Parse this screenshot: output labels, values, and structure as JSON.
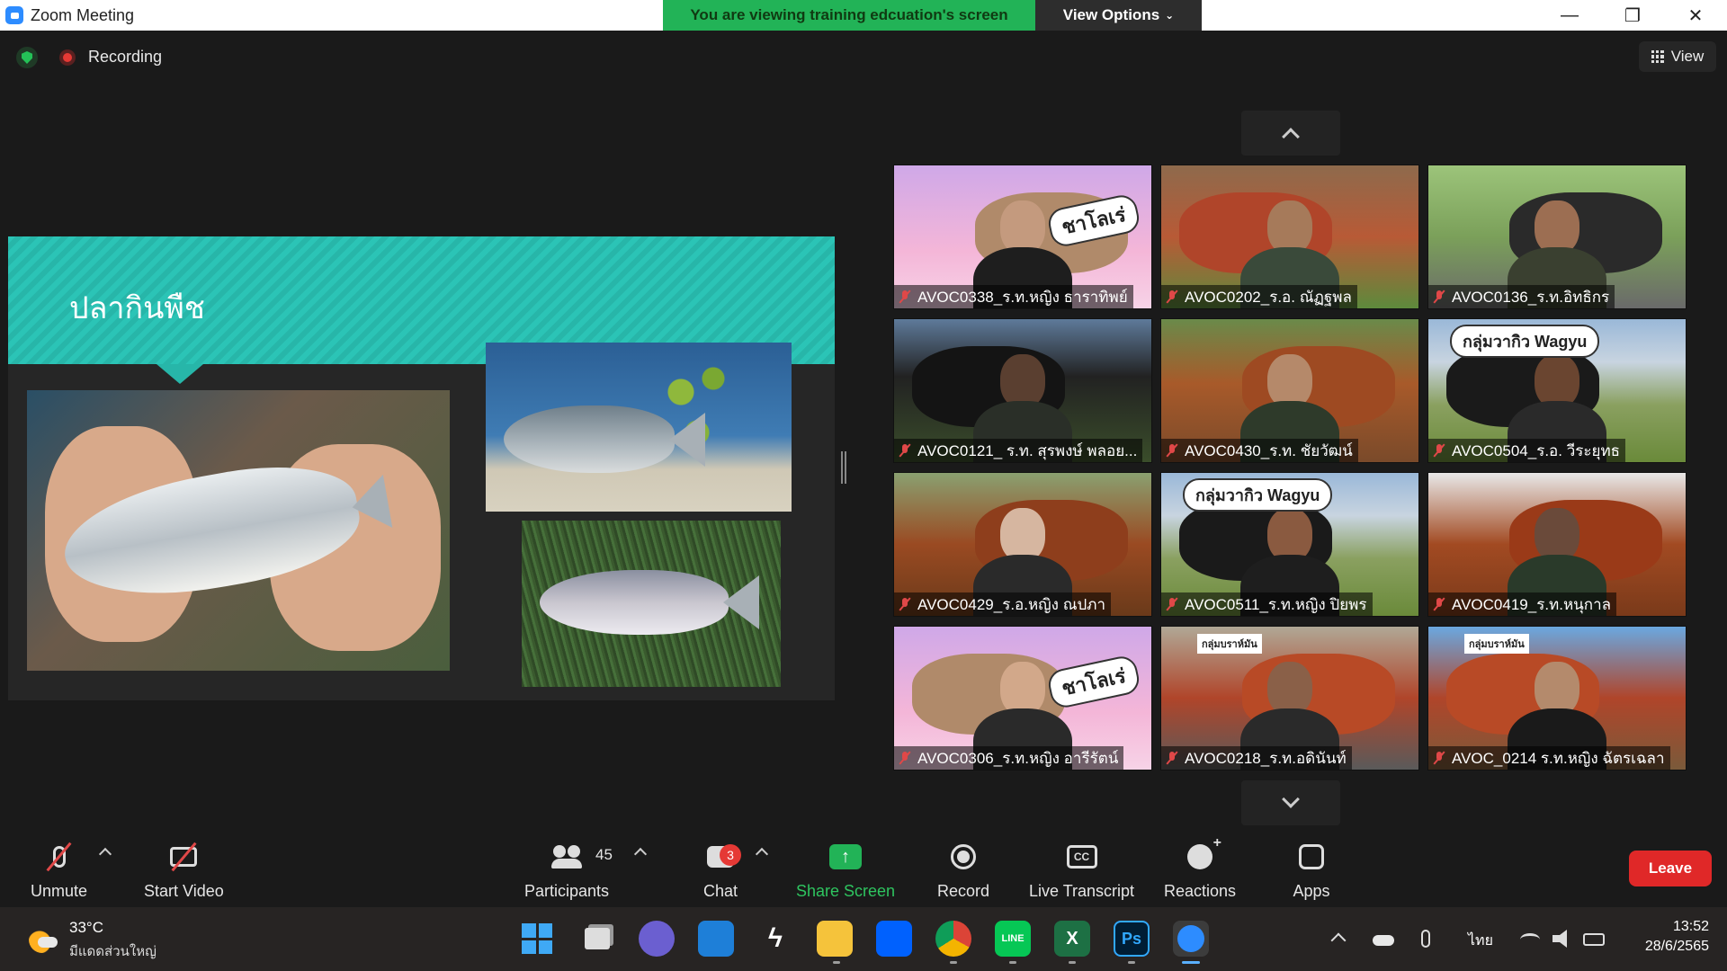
{
  "window": {
    "title": "Zoom Meeting",
    "share_banner": "You are viewing training edcuation's screen",
    "view_options": "View Options",
    "minimize": "—",
    "maximize": "❐",
    "close": "✕"
  },
  "meeting_bar": {
    "recording_label": "Recording",
    "view_label": "View"
  },
  "slide": {
    "title": "ปลากินพืช"
  },
  "participants_tiles": [
    {
      "name": "AVOC0338_ร.ท.หญิง ธาราทิพย์",
      "banner": "ชาโลเร่"
    },
    {
      "name": "AVOC0202_ร.อ. ณัฏฐพล",
      "banner": ""
    },
    {
      "name": "AVOC0136_ร.ท.อิทธิกร",
      "banner": ""
    },
    {
      "name": "AVOC0121_ ร.ท. สุรพงษ์ พลอย...",
      "banner": ""
    },
    {
      "name": "AVOC0430_ร.ท. ชัยวัฒน์",
      "banner": ""
    },
    {
      "name": "AVOC0504_ร.อ. วีระยุทธ",
      "banner": "กลุ่มวากิว Wagyu"
    },
    {
      "name": "AVOC0429_ร.อ.หญิง ณปภา",
      "banner": ""
    },
    {
      "name": "AVOC0511_ร.ท.หญิง ปิยพร",
      "banner": "กลุ่มวากิว Wagyu"
    },
    {
      "name": "AVOC0419_ร.ท.หนุกาล",
      "banner": ""
    },
    {
      "name": "AVOC0306_ร.ท.หญิง อารีรัตน์",
      "banner": "ชาโลเร่"
    },
    {
      "name": "AVOC0218_ร.ท.อดินันท์",
      "banner": "กลุ่มบราห์มัน"
    },
    {
      "name": "AVOC_0214 ร.ท.หญิง ฉัตรเฉลา",
      "banner": "กลุ่มบราห์มัน"
    }
  ],
  "toolbar": {
    "unmute": "Unmute",
    "start_video": "Start Video",
    "participants": "Participants",
    "participants_count": "45",
    "chat": "Chat",
    "chat_badge": "3",
    "share_screen": "Share Screen",
    "share_arrow": "↑",
    "record": "Record",
    "live_transcript": "Live Transcript",
    "cc": "CC",
    "reactions": "Reactions",
    "apps": "Apps",
    "leave": "Leave"
  },
  "taskbar": {
    "temperature": "33°C",
    "weather": "มีแดดส่วนใหญ่",
    "excel": "X",
    "photoshop": "Ps",
    "line": "LINE",
    "language": "ไทย",
    "time": "13:52",
    "date": "28/6/2565"
  },
  "colors": {
    "zoom_blue": "#2d8cff",
    "share_green": "#22b357",
    "leave_red": "#e02828",
    "slide_teal": "#2bc4b6"
  }
}
